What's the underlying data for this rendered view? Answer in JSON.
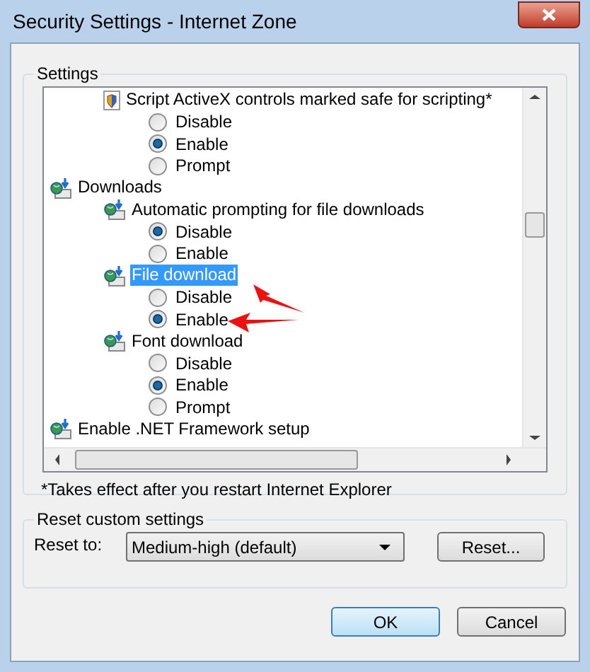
{
  "window": {
    "title": "Security Settings - Internet Zone"
  },
  "settings": {
    "title": "Settings",
    "tree": [
      {
        "kind": "setting",
        "label": "Script ActiveX controls marked safe for scripting*",
        "selected": false,
        "children": [
          {
            "label": "Disable",
            "selected": false
          },
          {
            "label": "Enable",
            "selected": true
          },
          {
            "label": "Prompt",
            "selected": false
          }
        ]
      },
      {
        "kind": "category",
        "label": "Downloads",
        "selected": false,
        "children": [
          {
            "kind": "setting",
            "label": "Automatic prompting for file downloads",
            "selected": false,
            "children": [
              {
                "label": "Disable",
                "selected": true
              },
              {
                "label": "Enable",
                "selected": false
              }
            ]
          },
          {
            "kind": "setting",
            "label": "File download",
            "selected": true,
            "children": [
              {
                "label": "Disable",
                "selected": false
              },
              {
                "label": "Enable",
                "selected": true
              }
            ]
          },
          {
            "kind": "setting",
            "label": "Font download",
            "selected": false,
            "children": [
              {
                "label": "Disable",
                "selected": false
              },
              {
                "label": "Enable",
                "selected": true
              },
              {
                "label": "Prompt",
                "selected": false
              }
            ]
          }
        ]
      },
      {
        "kind": "category",
        "label": "Enable .NET Framework setup",
        "selected": false
      }
    ],
    "note": "*Takes effect after you restart Internet Explorer"
  },
  "reset": {
    "title": "Reset custom settings",
    "label": "Reset to:",
    "value": "Medium-high (default)",
    "button": "Reset..."
  },
  "buttons": [
    {
      "label": "OK",
      "kind": "default"
    },
    {
      "label": "Cancel",
      "kind": "normal"
    }
  ]
}
